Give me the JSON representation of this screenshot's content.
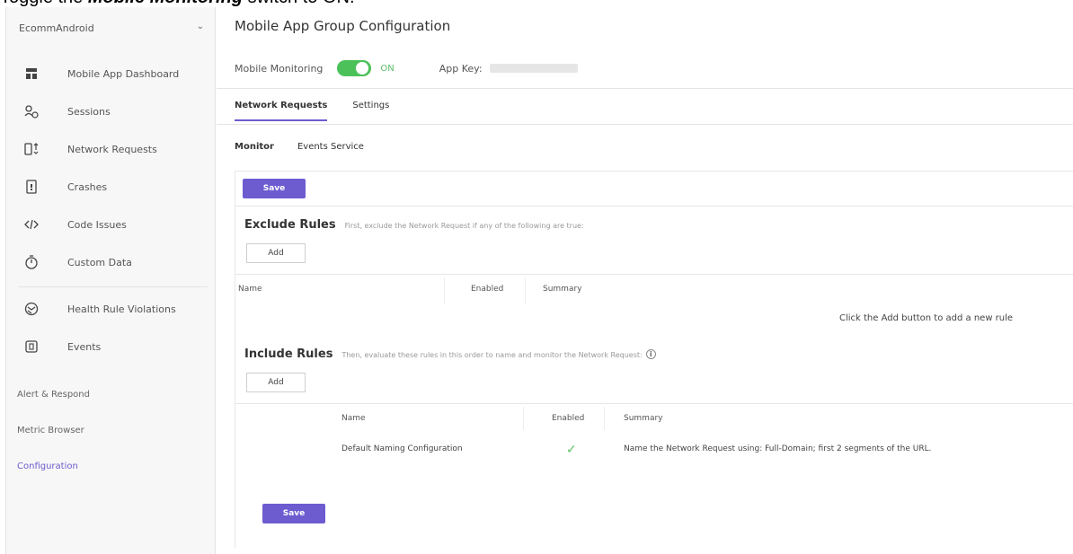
{
  "caption": {
    "prefix": "Toggle the ",
    "bold": "Mobile Monitoring",
    "suffix": " switch to ON."
  },
  "sidebar": {
    "app_name": "EcommAndroid",
    "nav_items": [
      {
        "label": "Mobile App Dashboard",
        "icon": "dashboard-icon"
      },
      {
        "label": "Sessions",
        "icon": "sessions-icon"
      },
      {
        "label": "Network Requests",
        "icon": "network-requests-icon"
      },
      {
        "label": "Crashes",
        "icon": "crash-icon"
      },
      {
        "label": "Code Issues",
        "icon": "code-issues-icon"
      },
      {
        "label": "Custom Data",
        "icon": "custom-data-icon"
      },
      {
        "label": "Health Rule Violations",
        "icon": "health-rule-icon"
      },
      {
        "label": "Events",
        "icon": "events-icon"
      }
    ],
    "alert_respond": "Alert & Respond",
    "metric_browser": "Metric Browser",
    "configuration": "Configuration"
  },
  "main": {
    "title": "Mobile App Group Configuration",
    "mobile_monitoring_label": "Mobile Monitoring",
    "toggle_state": "ON",
    "app_key_label": "App Key:",
    "tabs": [
      "Network Requests",
      "Settings"
    ],
    "subtabs": [
      "Monitor",
      "Events Service"
    ],
    "save_label": "Save",
    "exclude": {
      "title": "Exclude Rules",
      "desc": "First, exclude the Network Request if any of the following are true:",
      "add_label": "Add",
      "columns": [
        "Name",
        "Enabled",
        "Summary"
      ],
      "empty_msg": "Click the Add button to add a new rule"
    },
    "include": {
      "title": "Include Rules",
      "desc": "Then, evaluate these rules in this order to name and monitor the Network Request:",
      "add_label": "Add",
      "columns": [
        "Name",
        "Enabled",
        "Summary"
      ],
      "rows": [
        {
          "name": "Default Naming Configuration",
          "enabled": true,
          "summary": "Name the Network Request using: Full-Domain; first 2 segments of the URL."
        }
      ]
    },
    "colors": {
      "accent": "#6c5ccf",
      "toggle_on": "#4cc159"
    }
  }
}
